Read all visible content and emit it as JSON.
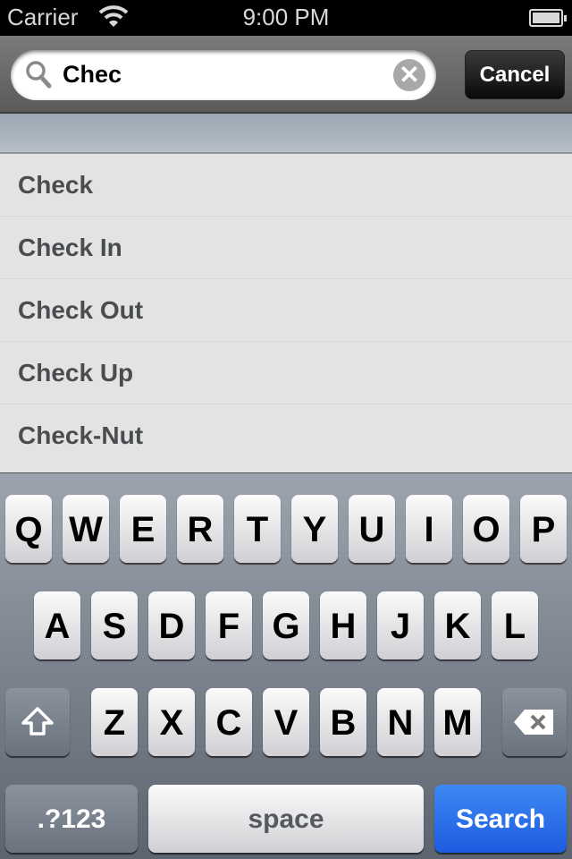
{
  "status_bar": {
    "carrier": "Carrier",
    "time": "9:00 PM",
    "battery_level": 1.0
  },
  "search": {
    "query": "Chec",
    "cancel_label": "Cancel"
  },
  "suggestions": [
    "Check",
    "Check In",
    "Check Out",
    "Check Up",
    "Check-Nut"
  ],
  "keyboard": {
    "row1": [
      "Q",
      "W",
      "E",
      "R",
      "T",
      "Y",
      "U",
      "I",
      "O",
      "P"
    ],
    "row2": [
      "A",
      "S",
      "D",
      "F",
      "G",
      "H",
      "J",
      "K",
      "L"
    ],
    "row3": [
      "Z",
      "X",
      "C",
      "V",
      "B",
      "N",
      "M"
    ],
    "numbers_label": ".?123",
    "space_label": "space",
    "search_label": "Search",
    "search_color": "#2a6ee8"
  }
}
